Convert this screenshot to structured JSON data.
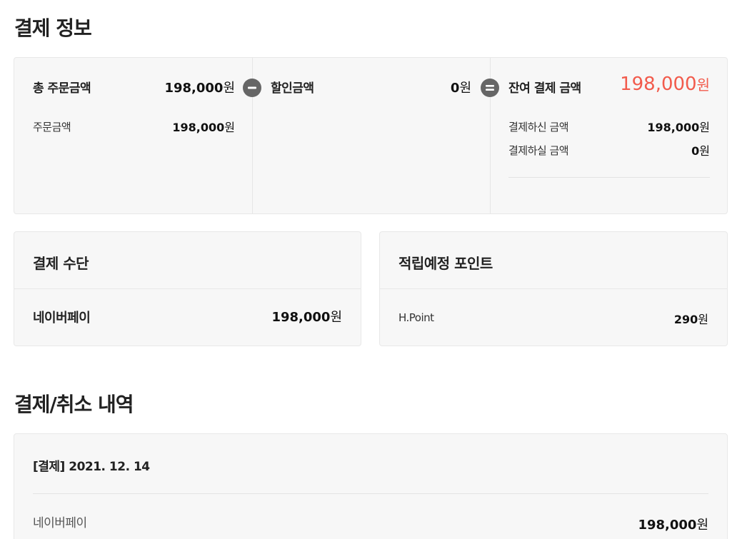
{
  "sections": {
    "payment_info_title": "결제 정보",
    "history_title": "결제/취소 내역"
  },
  "summary": {
    "total": {
      "label": "총 주문금액",
      "amount": "198,000",
      "unit": "원",
      "sub_label": "주문금액",
      "sub_amount": "198,000",
      "sub_unit": "원"
    },
    "discount": {
      "label": "할인금액",
      "amount": "0",
      "unit": "원"
    },
    "balance": {
      "label": "잔여 결제 금액",
      "amount": "198,000",
      "unit": "원",
      "paid_label": "결제하신 금액",
      "paid_amount": "198,000",
      "paid_unit": "원",
      "topay_label": "결제하실 금액",
      "topay_amount": "0",
      "topay_unit": "원"
    }
  },
  "payment_method": {
    "title": "결제 수단",
    "name": "네이버페이",
    "amount": "198,000",
    "unit": "원"
  },
  "points": {
    "title": "적립예정 포인트",
    "name": "H.Point",
    "amount": "290",
    "unit": "원"
  },
  "history": {
    "entry_title": "[결제] 2021. 12. 14",
    "method": "네이버페이",
    "amount": "198,000",
    "unit": "원"
  },
  "icons": {
    "minus": "minus-circle-icon",
    "equals": "equals-circle-icon"
  },
  "colors": {
    "accent_red": "#f25b4c",
    "card_bg": "#f7f7f7",
    "operator_bg": "#666666"
  }
}
